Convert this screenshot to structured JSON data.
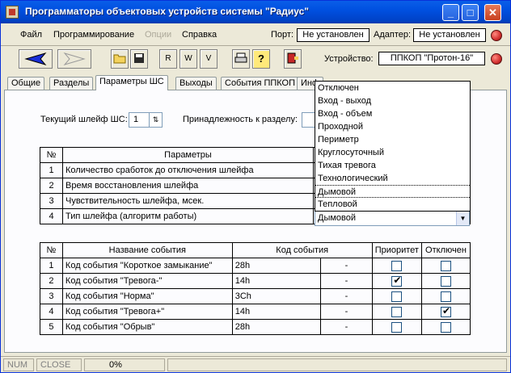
{
  "window": {
    "title": "Программаторы объектовых устройств системы \"Радиус\""
  },
  "menu": {
    "file": "Файл",
    "programming": "Программирование",
    "options": "Опции",
    "help": "Справка"
  },
  "port": {
    "label": "Порт:",
    "value": "Не установлен"
  },
  "adapter": {
    "label": "Адаптер:",
    "value": "Не установлен"
  },
  "device": {
    "label": "Устройство:",
    "value": "ППКОП \"Протон-16\""
  },
  "tabs": [
    "Общие",
    "Разделы",
    "Параметры ШС",
    "Выходы",
    "События ППКОП",
    "Инф"
  ],
  "current_loop": {
    "label": "Текущий шлейф ШС:",
    "value": "1"
  },
  "partition": {
    "label": "Принадлежность к разделу:"
  },
  "params_table": {
    "headers": [
      "№",
      "Параметры"
    ],
    "rows": [
      {
        "n": "1",
        "name": "Количество сработок до отключения шлейфа"
      },
      {
        "n": "2",
        "name": "Время восстановления шлейфа"
      },
      {
        "n": "3",
        "name": "Чувствительность шлейфа, мсек."
      },
      {
        "n": "4",
        "name": "Тип шлейфа (алгоритм работы)"
      }
    ]
  },
  "loop_type": {
    "selected": "Дымовой",
    "options": [
      "Отключен",
      "Вход - выход",
      "Вход - объем",
      "Проходной",
      "Периметр",
      "Круглосуточный",
      "Тихая тревога",
      "Технологический",
      "Дымовой",
      "Тепловой"
    ]
  },
  "events_table": {
    "headers": [
      "№",
      "Название события",
      "Код события",
      "Приоритет",
      "Отключен"
    ],
    "rows": [
      {
        "n": "1",
        "name": "Код события \"Короткое замыкание\"",
        "code": "28h",
        "sep": "-",
        "priority": false,
        "disabled": false
      },
      {
        "n": "2",
        "name": "Код события \"Тревога-\"",
        "code": "14h",
        "sep": "-",
        "priority": true,
        "disabled": false
      },
      {
        "n": "3",
        "name": "Код события \"Норма\"",
        "code": "3Ch",
        "sep": "-",
        "priority": false,
        "disabled": false
      },
      {
        "n": "4",
        "name": "Код события \"Тревога+\"",
        "code": "14h",
        "sep": "-",
        "priority": false,
        "disabled": true
      },
      {
        "n": "5",
        "name": "Код события \"Обрыв\"",
        "code": "28h",
        "sep": "-",
        "priority": false,
        "disabled": false
      }
    ]
  },
  "statusbar": {
    "num": "NUM",
    "close": "CLOSE",
    "progress": "0%"
  }
}
